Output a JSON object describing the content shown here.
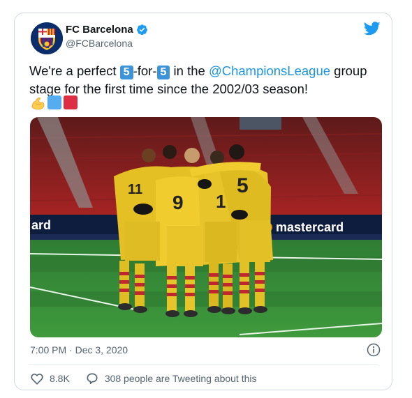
{
  "tweet": {
    "display_name": "FC Barcelona",
    "handle": "@FCBarcelona",
    "verified": true,
    "text_part1": "We're a perfect ",
    "keycap_a": "5",
    "text_part2": "-for-",
    "keycap_b": "5",
    "text_part3": " in the ",
    "mention": "@ChampionsLeague",
    "text_part4": " group stage for the first time since the 2002/03 season!",
    "emojis": [
      "flexed-biceps",
      "blue-square",
      "red-square"
    ],
    "timestamp": "7:00 PM · Dec 3, 2020",
    "likes": "8.8K",
    "replies_text": "308 people are Tweeting about this",
    "photo": {
      "ad_board_left": "ard",
      "ad_board_right": "mastercard"
    }
  },
  "colors": {
    "twitter_blue": "#1d9bf0",
    "mention": "#1b95e0",
    "verified": "#1d9bf0",
    "secondary_text": "#536471"
  },
  "icons": [
    "twitter-bird-icon",
    "verified-badge-icon",
    "info-icon",
    "heart-icon",
    "reply-bubble-icon"
  ]
}
